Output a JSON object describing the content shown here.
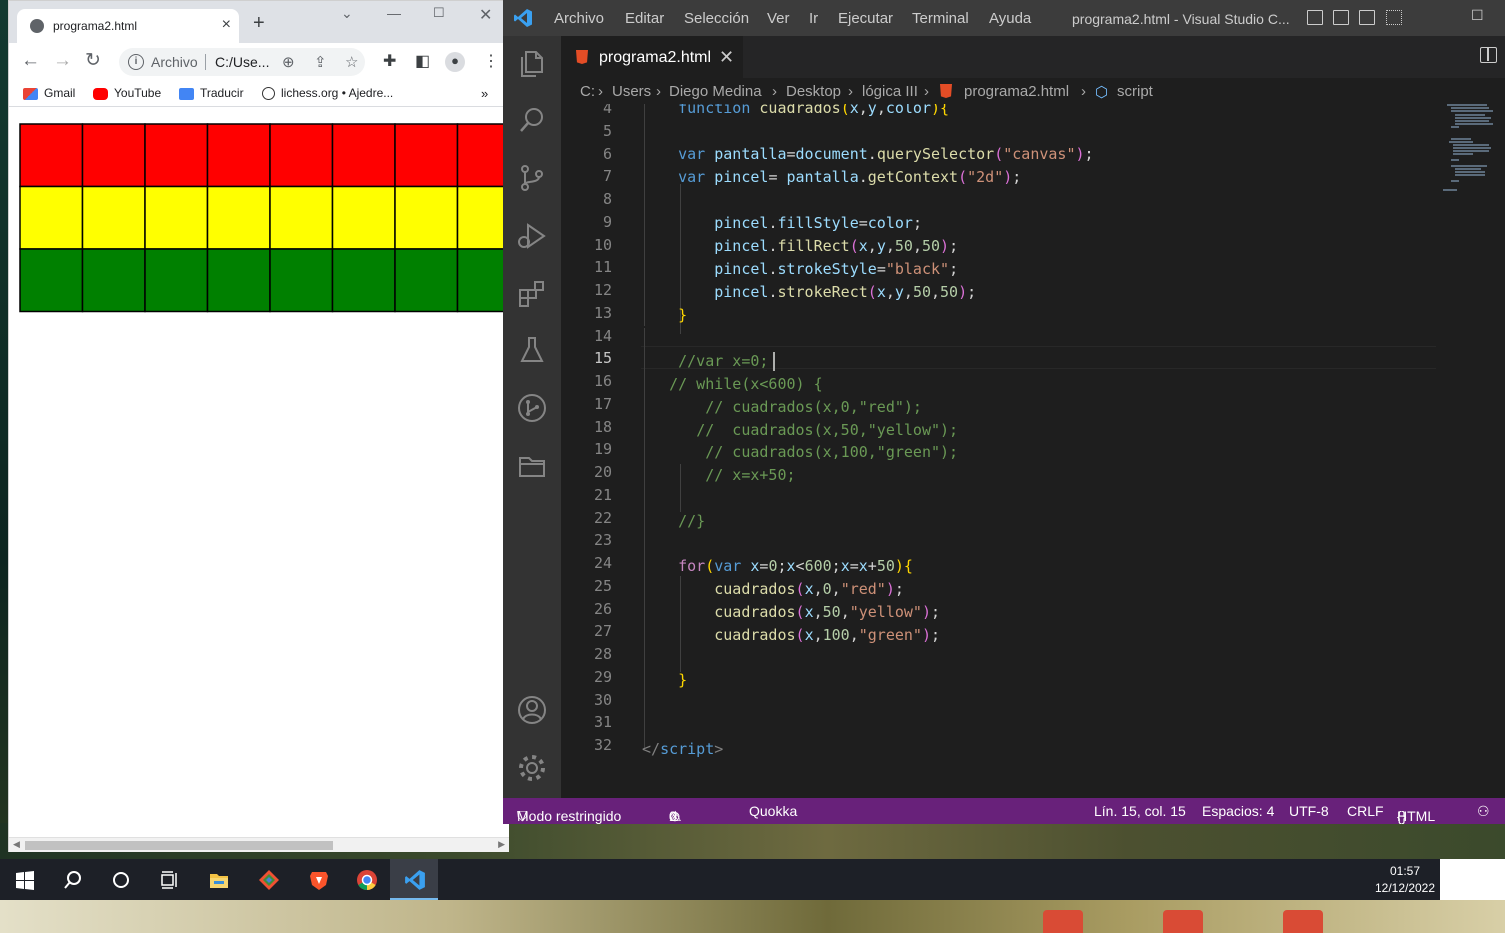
{
  "browser": {
    "tab_title": "programa2.html",
    "omnibox_scheme": "Archivo",
    "omnibox_url": "C:/Use...",
    "bookmarks": [
      "Gmail",
      "YouTube",
      "Traducir",
      "lichess.org • Ajedre..."
    ],
    "canvas_rows": [
      "red",
      "yellow",
      "green"
    ],
    "canvas_columns": 8
  },
  "vscode": {
    "menu": [
      "Archivo",
      "Editar",
      "Selección",
      "Ver",
      "Ir",
      "Ejecutar",
      "Terminal",
      "Ayuda"
    ],
    "window_title": "programa2.html - Visual Studio C...",
    "tab_name": "programa2.html",
    "breadcrumb": [
      "C:",
      "Users",
      "Diego Medina",
      "Desktop",
      "lógica III",
      "programa2.html",
      "script"
    ],
    "line_numbers": [
      "4",
      "5",
      "6",
      "7",
      "8",
      "9",
      "10",
      "11",
      "12",
      "13",
      "14",
      "15",
      "16",
      "17",
      "18",
      "19",
      "20",
      "21",
      "22",
      "23",
      "24",
      "25",
      "26",
      "27",
      "28",
      "29",
      "30",
      "31",
      "32"
    ],
    "current_line": "15",
    "status": {
      "restricted": "Modo restringido",
      "errors": "0",
      "warnings": "0",
      "quokka": "Quokka",
      "position": "Lín. 15, col. 15",
      "spaces": "Espacios: 4",
      "encoding": "UTF-8",
      "eol": "CRLF",
      "language": "HTML"
    }
  },
  "taskbar": {
    "time": "01:57",
    "date": "12/12/2022"
  },
  "colors": {
    "status_bar": "#68217a",
    "editor_bg": "#1e1e1e",
    "row_red": "#ff0000",
    "row_yellow": "#ffff00",
    "row_green": "#008000"
  }
}
